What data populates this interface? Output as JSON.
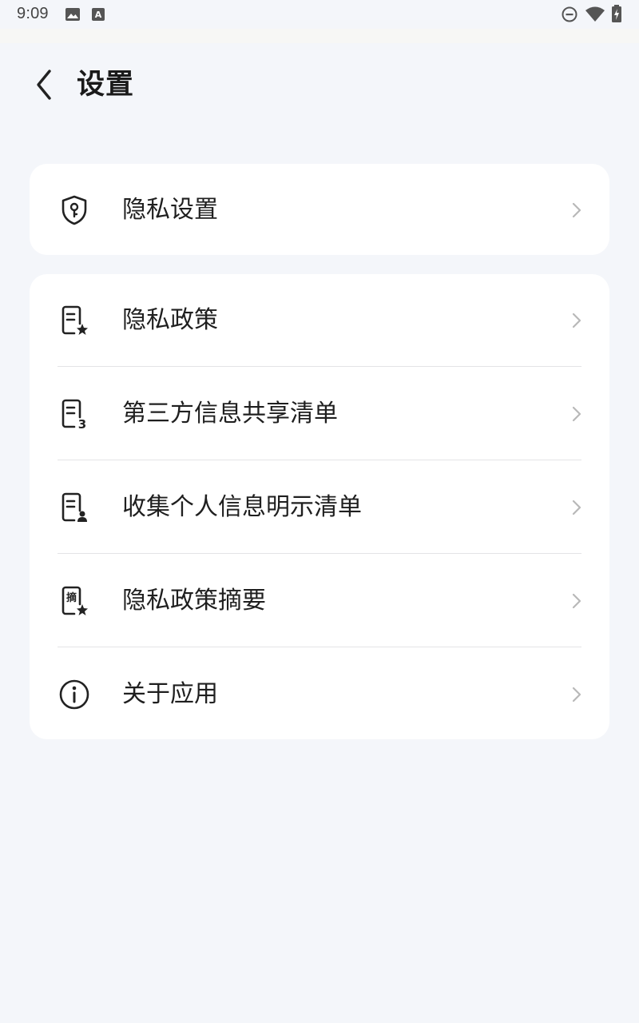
{
  "status_bar": {
    "time": "9:09",
    "left_icons": [
      "image-icon",
      "text-a-icon"
    ],
    "right_icons": [
      "do-not-disturb-icon",
      "wifi-icon",
      "battery-charging-icon"
    ]
  },
  "header": {
    "back_icon": "chevron-left-icon",
    "title": "设置"
  },
  "card1": {
    "items": [
      {
        "label": "隐私设置",
        "icon": "shield-key-icon"
      }
    ]
  },
  "card2": {
    "items": [
      {
        "label": "隐私政策",
        "icon": "document-star-icon"
      },
      {
        "label": "第三方信息共享清单",
        "icon": "document-three-icon"
      },
      {
        "label": "收集个人信息明示清单",
        "icon": "document-person-icon"
      },
      {
        "label": "隐私政策摘要",
        "icon": "document-summary-icon"
      },
      {
        "label": "关于应用",
        "icon": "info-icon"
      }
    ]
  },
  "document_summary_glyph": "摘",
  "document_three_glyph": "3",
  "colors": {
    "background": "#f4f6fa",
    "card": "#ffffff",
    "text": "#1a1a1a",
    "chevron": "#b8b8b8",
    "divider": "#e4e4e6"
  }
}
